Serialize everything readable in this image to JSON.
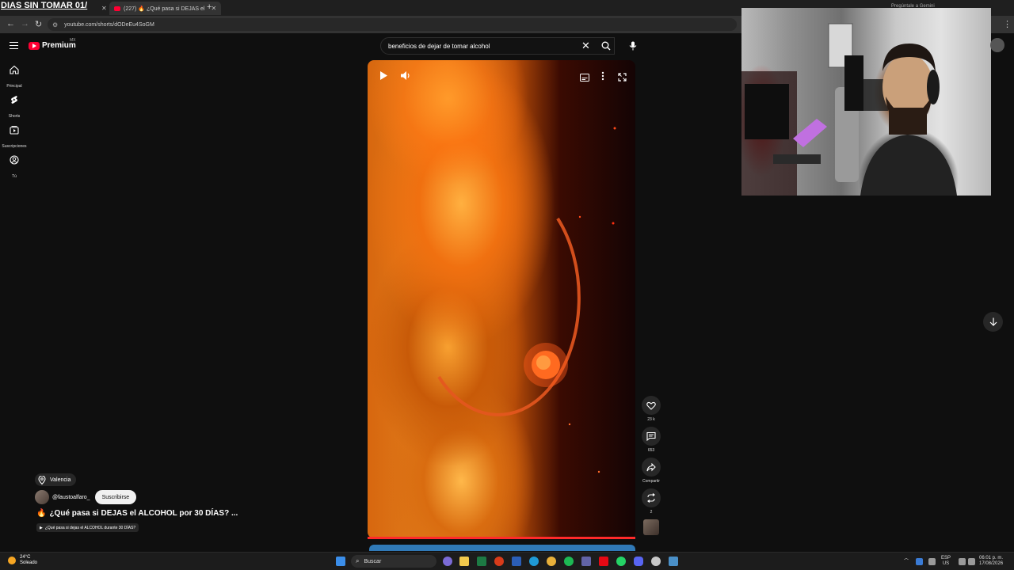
{
  "overlay_title": "DIAS SIN TOMAR 01/",
  "tabs": [
    {
      "label": "",
      "active": false
    },
    {
      "label": "(227) 🔥 ¿Qué pasa si DEJAS el",
      "active": true
    }
  ],
  "address": {
    "url": "youtube.com/shorts/dODeEu4SoGM"
  },
  "header": {
    "brand": "Premium",
    "region": "MX"
  },
  "search": {
    "query": "beneficios de dejar de tomar alcohol"
  },
  "sidebar": {
    "items": [
      {
        "label": "Principal",
        "icon": "home-icon"
      },
      {
        "label": "Shorts",
        "icon": "shorts-icon"
      },
      {
        "label": "Suscripciones",
        "icon": "subscriptions-icon"
      },
      {
        "label": "Tú",
        "icon": "you-icon"
      }
    ]
  },
  "video": {
    "progress": 1.0
  },
  "actions": {
    "likes": "23 k",
    "comments": "653",
    "share": "Compartir",
    "remix": "2"
  },
  "meta": {
    "location": "Valencia",
    "handle": "@faustoalfaro_",
    "subscribe": "Suscribirse",
    "title": "¿Qué pasa si DEJAS el ALCOHOL por 30 DÍAS? ...",
    "playlist": "¿Qué pasa si dejas el ALCOHOL durante 30 DÍAS?"
  },
  "webcam": {
    "label": "Pregúntale a Gemini"
  },
  "taskbar": {
    "temperature": "24°C",
    "weather": "Soleado",
    "search_placeholder": "Buscar",
    "lang_top": "ESP",
    "lang_bottom": "US",
    "time": "06:01 p. m.",
    "date": "17/08/2026"
  },
  "colors": {
    "accent": "#ff0033",
    "progress": "#ff2a2a",
    "background": "#0f0f0f"
  }
}
